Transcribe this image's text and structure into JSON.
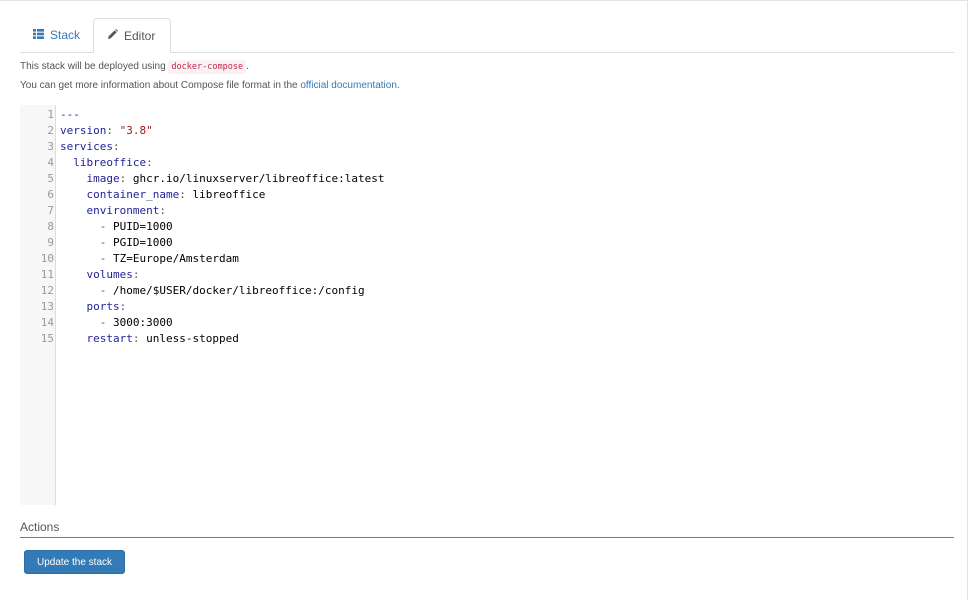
{
  "tabs": [
    {
      "label": "Stack",
      "icon": "list-icon",
      "active": false
    },
    {
      "label": "Editor",
      "icon": "pencil-icon",
      "active": true
    }
  ],
  "info": {
    "line1_prefix": "This stack will be deployed using",
    "line1_code": "docker-compose",
    "line1_suffix": ".",
    "line2_prefix": "You can get more information about Compose file format in the",
    "line2_link": "official documentation",
    "line2_suffix": "."
  },
  "editor": {
    "line_numbers": "1\n2\n3\n4\n5\n6\n7\n8\n9\n10\n11\n12\n13\n14\n15",
    "lines": [
      {
        "k": "---",
        "p": "",
        "v": ""
      },
      {
        "k": "version",
        "p": ": ",
        "v": "\"3.8\""
      },
      {
        "k": "services",
        "p": ":",
        "v": ""
      },
      {
        "k": "  libreoffice",
        "p": ":",
        "v": ""
      },
      {
        "k": "    image",
        "p": ": ",
        "v": "ghcr.io/linuxserver/libreoffice:latest"
      },
      {
        "k": "    container_name",
        "p": ": ",
        "v": "libreoffice"
      },
      {
        "k": "    environment",
        "p": ":",
        "v": ""
      },
      {
        "k": "      ",
        "p": "- ",
        "v": "PUID=1000"
      },
      {
        "k": "      ",
        "p": "- ",
        "v": "PGID=1000"
      },
      {
        "k": "      ",
        "p": "- ",
        "v": "TZ=Europe/Amsterdam"
      },
      {
        "k": "    volumes",
        "p": ":",
        "v": ""
      },
      {
        "k": "      ",
        "p": "- ",
        "v": "/home/$USER/docker/libreoffice:/config"
      },
      {
        "k": "    ports",
        "p": ":",
        "v": ""
      },
      {
        "k": "      ",
        "p": "- ",
        "v": "3000:3000"
      },
      {
        "k": "    restart",
        "p": ": ",
        "v": "unless-stopped"
      }
    ]
  },
  "actions": {
    "title": "Actions",
    "update_label": "Update the stack"
  },
  "colors": {
    "accent": "#337ab7",
    "yaml_key": "#1f1f9a",
    "yaml_string": "#a11a1a",
    "inline_code": "#c7254e"
  }
}
